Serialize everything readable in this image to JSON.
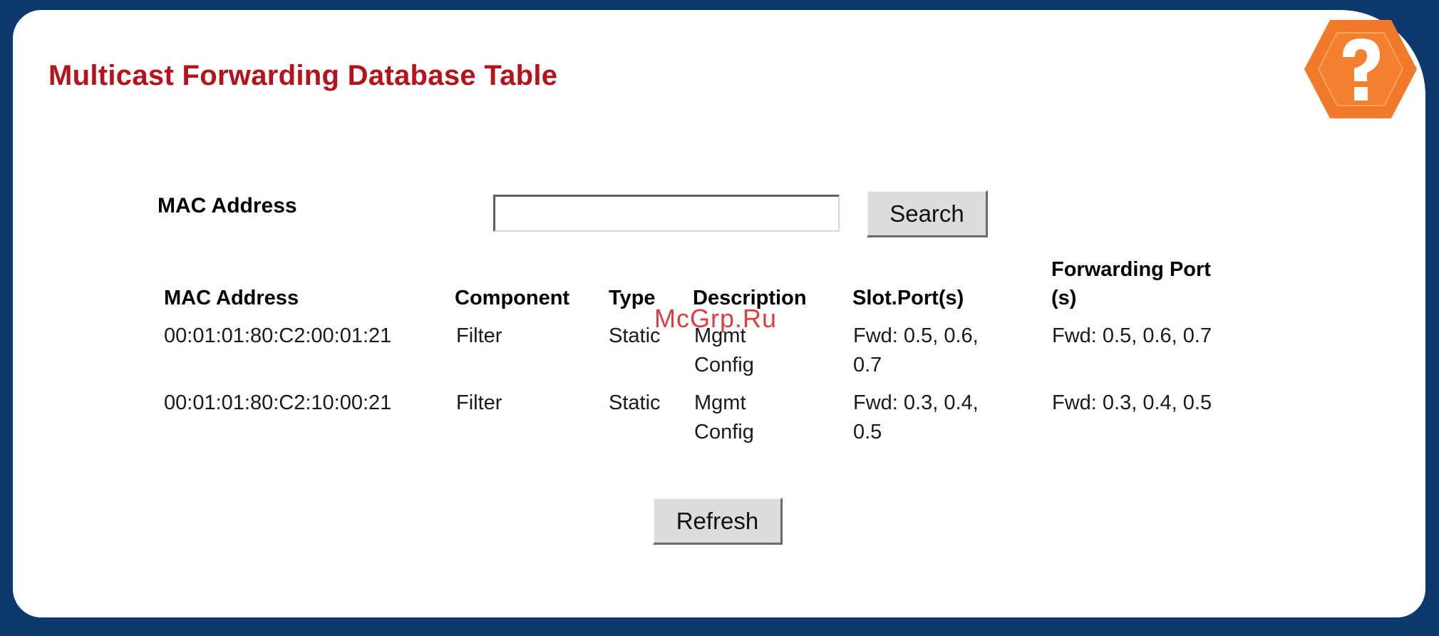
{
  "page": {
    "title": "Multicast Forwarding Database Table",
    "background_color": "#0d3a6e",
    "title_color": "#b5121b"
  },
  "help": {
    "icon": "help-question-icon",
    "color": "#f07a2a"
  },
  "search": {
    "label": "MAC Address",
    "value": "",
    "button_label": "Search"
  },
  "table": {
    "headers": {
      "mac": "MAC Address",
      "component": "Component",
      "type": "Type",
      "description": "Description",
      "slot_ports": "Slot.Port(s)",
      "forwarding_port_line1": "Forwarding Port",
      "forwarding_port_line2": "(s)"
    },
    "rows": [
      {
        "mac": "00:01:01:80:C2:00:01:21",
        "component": "Filter",
        "type": "Static",
        "description_line1": "Mgmt",
        "description_line2": "Config",
        "slot_ports_line1": "Fwd: 0.5, 0.6,",
        "slot_ports_line2": "0.7",
        "forwarding_port": "Fwd: 0.5, 0.6, 0.7"
      },
      {
        "mac": "00:01:01:80:C2:10:00:21",
        "component": "Filter",
        "type": "Static",
        "description_line1": "Mgmt",
        "description_line2": "Config",
        "slot_ports_line1": "Fwd: 0.3, 0.4,",
        "slot_ports_line2": "0.5",
        "forwarding_port": "Fwd: 0.3, 0.4, 0.5"
      }
    ]
  },
  "refresh": {
    "button_label": "Refresh"
  },
  "watermark": {
    "text": "McGrp.Ru"
  }
}
